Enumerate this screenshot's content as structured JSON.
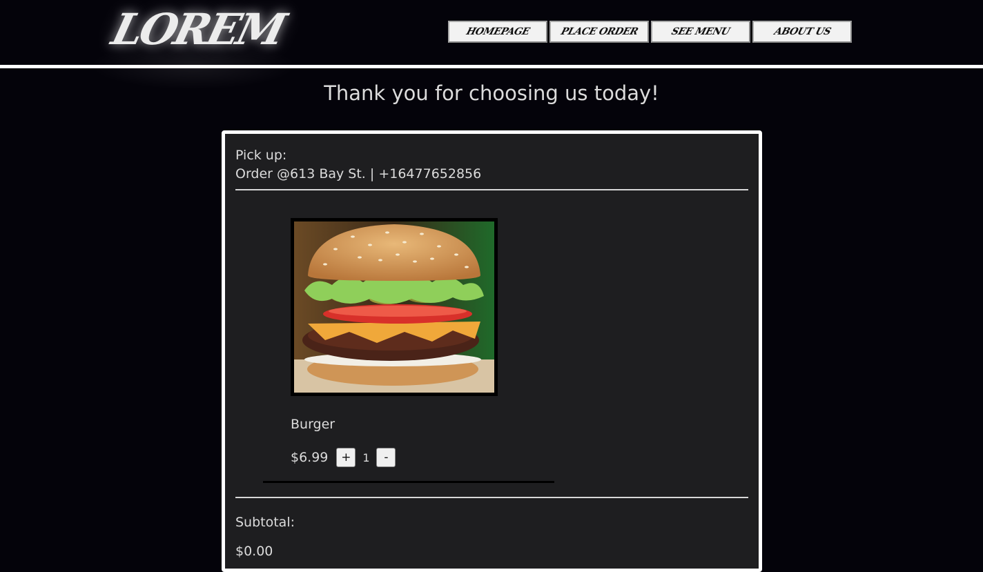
{
  "header": {
    "logo_text": "LOREM",
    "nav": [
      {
        "label": "HOMEPAGE"
      },
      {
        "label": "PLACE ORDER"
      },
      {
        "label": "SEE MENU"
      },
      {
        "label": "ABOUT US"
      }
    ]
  },
  "main": {
    "thanks_message": "Thank you for choosing us today!",
    "pickup_label": "Pick up:",
    "pickup_address": "Order @613 Bay St. | +16477652856",
    "item": {
      "name": "Burger",
      "price": "$6.99",
      "increment_label": "+",
      "quantity": "1",
      "decrement_label": "-"
    },
    "subtotal_label": "Subtotal:",
    "subtotal_value": "$0.00"
  },
  "colors": {
    "background": "#04030a",
    "panel": "#1e1e20",
    "border": "#ffffff",
    "text": "#dcdcdc"
  }
}
